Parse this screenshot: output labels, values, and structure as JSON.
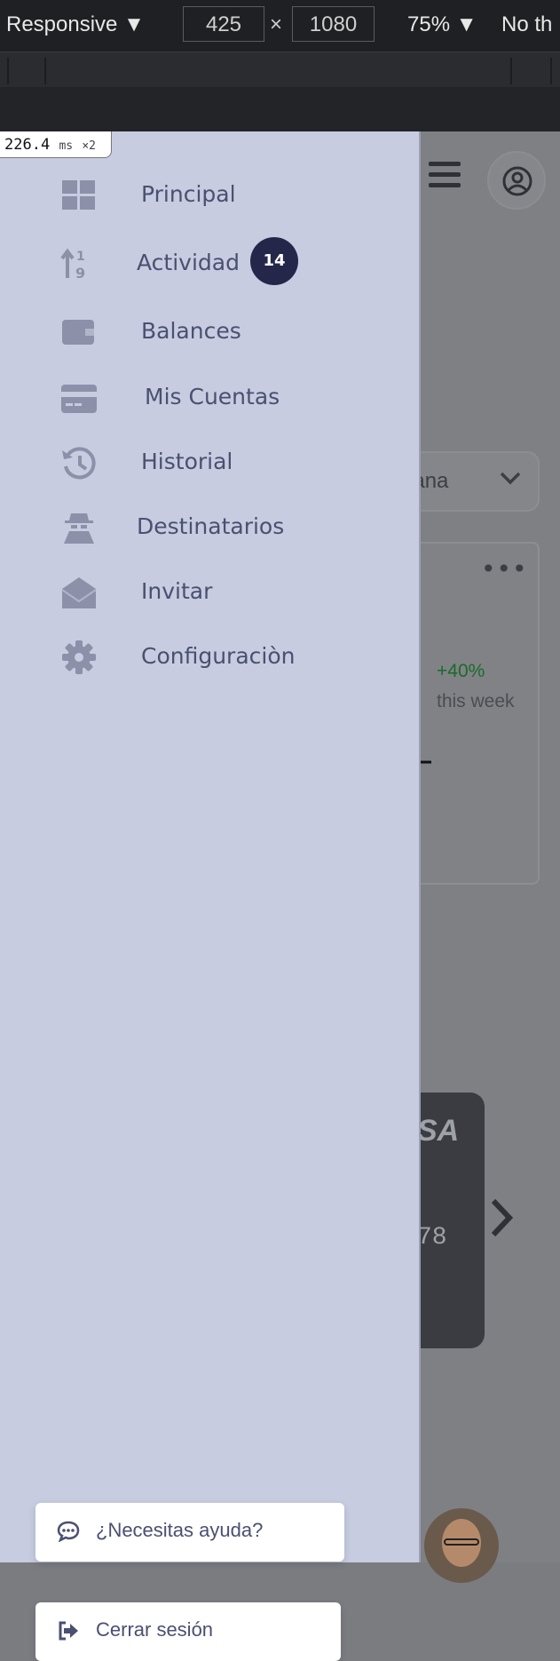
{
  "devtools": {
    "device": "Responsive ▼",
    "width": "425",
    "times": "×",
    "height": "1080",
    "zoom": "75% ▼",
    "throttle": "No th",
    "timing_value": "226.4",
    "timing_unit": "ms",
    "timing_mult": "×2"
  },
  "page": {
    "period_label": "nana",
    "menu_dots": "•••",
    "growth_pct": "+40%",
    "growth_period": "this week",
    "card_brand": "SA",
    "card_digits": "78"
  },
  "drawer": {
    "items": [
      {
        "label": "Principal",
        "icon": "grid-icon"
      },
      {
        "label": "Actividad",
        "icon": "sort-numeric-icon",
        "badge": "14"
      },
      {
        "label": "Balances",
        "icon": "wallet-icon"
      },
      {
        "label": "Mis Cuentas",
        "icon": "credit-card-icon"
      },
      {
        "label": "Historial",
        "icon": "history-icon"
      },
      {
        "label": "Destinatarios",
        "icon": "user-secret-icon"
      },
      {
        "label": "Invitar",
        "icon": "envelope-open-icon"
      },
      {
        "label": "Configuraciòn",
        "icon": "gear-icon"
      }
    ],
    "help_label": "¿Necesitas ayuda?",
    "logout_label": "Cerrar sesión"
  },
  "colors": {
    "drawer_bg": "#c7cce0",
    "badge_bg": "#25274a",
    "text": "#4a5070",
    "icon": "#8c90a8",
    "positive": "#1b6a2b"
  }
}
